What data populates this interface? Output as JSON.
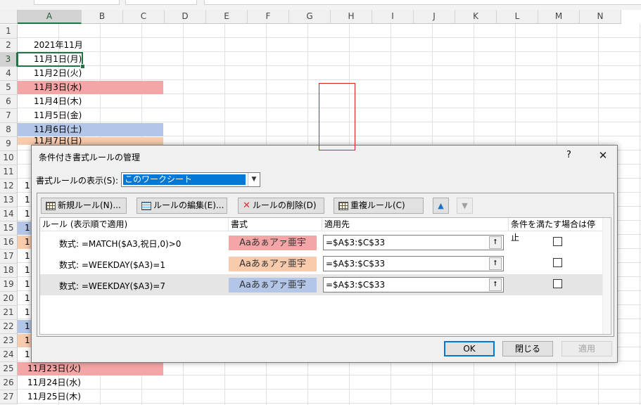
{
  "sheet": {
    "columns": [
      "A",
      "B",
      "C",
      "D",
      "E",
      "F",
      "G",
      "H",
      "I",
      "J",
      "K",
      "L",
      "M",
      "N"
    ],
    "rows": [
      "1",
      "2",
      "3",
      "4",
      "5",
      "6",
      "7",
      "8",
      "9",
      "10",
      "11",
      "12",
      "13",
      "14",
      "15",
      "16",
      "17",
      "18",
      "19",
      "20",
      "21",
      "22",
      "23",
      "24",
      "25",
      "26",
      "27"
    ],
    "cells": {
      "a2": "2021年11月",
      "a3": "11月1日(月)",
      "a4": "11月2日(火)",
      "a5": "11月3日(水)",
      "a6": "11月4日(木)",
      "a7": "11月5日(金)",
      "a8": "11月6日(土)",
      "a9": "11月7日(日)",
      "a25": "11月23日(火)",
      "a26": "11月24日(水)",
      "a27": "11月25日(木)",
      "peek_char": "1"
    },
    "colors": {
      "holiday": "#f4a6a6",
      "saturday": "#b4c6e7",
      "sunday": "#f8cbad",
      "active_border": "#217346"
    }
  },
  "dialog": {
    "title": "条件付き書式ルールの管理",
    "help": "?",
    "close": "✕",
    "show_rules_label": "書式ルールの表示(S):",
    "scope_value": "このワークシート",
    "toolbar": {
      "new_rule": "新規ルール(N)...",
      "edit_rule": "ルールの編集(E)...",
      "delete_rule": "ルールの削除(D)",
      "duplicate_rule": "重複ルール(C)",
      "move_up": "▲",
      "move_down": "▼"
    },
    "headers": {
      "rule": "ルール (表示順で適用)",
      "format": "書式",
      "applies_to": "適用先",
      "stop_if_true": "条件を満たす場合は停止"
    },
    "rules": [
      {
        "rule": "数式: =MATCH($A3,祝日,0)>0",
        "format": "Aaあぁアァ亜宇",
        "format_color": "#f4a6a6",
        "applies_to": "=$A$3:$C$33",
        "stop": false
      },
      {
        "rule": "数式: =WEEKDAY($A3)=1",
        "format": "Aaあぁアァ亜宇",
        "format_color": "#f8cbad",
        "applies_to": "=$A$3:$C$33",
        "stop": false
      },
      {
        "rule": "数式: =WEEKDAY($A3)=7",
        "format": "Aaあぁアァ亜宇",
        "format_color": "#b4c6e7",
        "applies_to": "=$A$3:$C$33",
        "stop": false
      }
    ],
    "range_picker_icon": "⭡",
    "buttons": {
      "ok": "OK",
      "close": "閉じる",
      "apply": "適用"
    }
  }
}
